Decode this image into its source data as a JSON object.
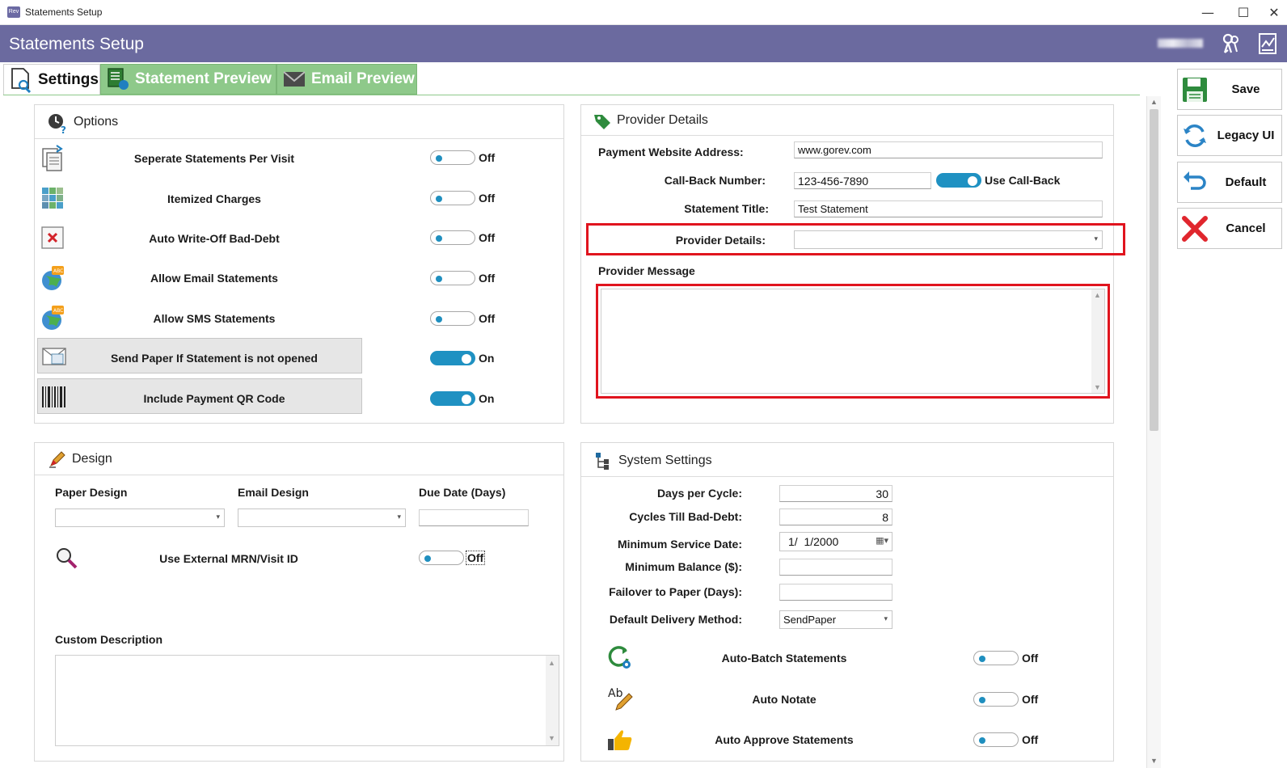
{
  "window": {
    "title": "Statements Setup",
    "app_icon_text": "Rev",
    "minimize": "—",
    "maximize": "☐",
    "close": "✕"
  },
  "header": {
    "title": "Statements Setup"
  },
  "tabs": [
    {
      "label": "Settings",
      "active": true
    },
    {
      "label": "Statement Preview",
      "active": false
    },
    {
      "label": "Email Preview",
      "active": false
    }
  ],
  "options": {
    "title": "Options",
    "rows": [
      {
        "label": "Seperate Statements Per Visit",
        "state": "Off",
        "on": false,
        "icon": "documents-icon"
      },
      {
        "label": "Itemized Charges",
        "state": "Off",
        "on": false,
        "icon": "grid-icon"
      },
      {
        "label": "Auto Write-Off Bad-Debt",
        "state": "Off",
        "on": false,
        "icon": "write-off-icon"
      },
      {
        "label": "Allow Email Statements",
        "state": "Off",
        "on": false,
        "icon": "globe-abc-icon"
      },
      {
        "label": "Allow SMS Statements",
        "state": "Off",
        "on": false,
        "icon": "globe-abc-icon"
      },
      {
        "label": "Send Paper If Statement is not opened",
        "state": "On",
        "on": true,
        "icon": "paper-icon"
      },
      {
        "label": "Include Payment QR Code",
        "state": "On",
        "on": true,
        "icon": "barcode-icon"
      }
    ]
  },
  "provider": {
    "title": "Provider Details",
    "website_label": "Payment Website Address:",
    "website_value": "www.gorev.com",
    "callback_label": "Call-Back Number:",
    "callback_value": "123-456-7890",
    "use_callback_label": "Use Call-Back",
    "use_callback_on": true,
    "statement_title_label": "Statement Title:",
    "statement_title_value": "Test Statement",
    "provider_details_label": "Provider Details:",
    "provider_details_value": "",
    "message_label": "Provider Message",
    "message_value": ""
  },
  "design": {
    "title": "Design",
    "paper_design_label": "Paper Design",
    "email_design_label": "Email Design",
    "due_date_label": "Due Date (Days)",
    "paper_design_value": "",
    "email_design_value": "",
    "due_date_value": "",
    "external_mrn_label": "Use External MRN/Visit ID",
    "external_mrn_state": "Off",
    "custom_description_label": "Custom Description"
  },
  "system": {
    "title": "System Settings",
    "days_per_cycle_label": "Days per Cycle:",
    "days_per_cycle_value": "30",
    "cycles_bad_debt_label": "Cycles Till Bad-Debt:",
    "cycles_bad_debt_value": "8",
    "min_service_date_label": "Minimum Service Date:",
    "min_service_date_value": "1/  1/2000",
    "min_balance_label": "Minimum Balance ($):",
    "min_balance_value": "",
    "failover_label": "Failover to Paper (Days):",
    "failover_value": "",
    "delivery_label": "Default Delivery Method:",
    "delivery_value": "SendPaper",
    "toggles": [
      {
        "label": "Auto-Batch Statements",
        "state": "Off",
        "icon": "refresh-gear-icon"
      },
      {
        "label": "Auto Notate",
        "state": "Off",
        "icon": "ab-pencil-icon"
      },
      {
        "label": "Auto Approve Statements",
        "state": "Off",
        "icon": "thumbs-up-icon"
      }
    ]
  },
  "actions": {
    "save": "Save",
    "legacy": "Legacy UI",
    "default": "Default",
    "cancel": "Cancel"
  },
  "colors": {
    "header": "#6b6a9f",
    "tab_inactive": "#8ec98a",
    "toggle_on": "#1f91c2",
    "highlight": "#e0141e"
  }
}
